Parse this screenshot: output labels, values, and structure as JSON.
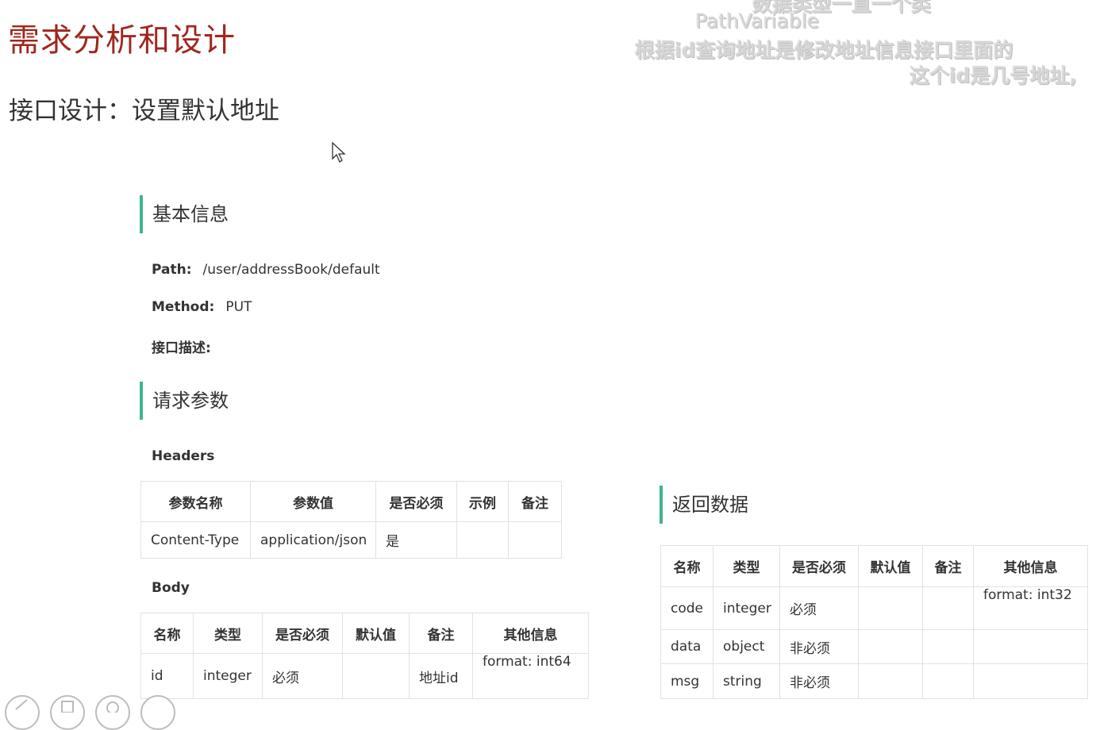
{
  "title": "需求分析和设计",
  "subtitle": "接口设计：设置默认地址",
  "overlay": {
    "line0": "数据类型一直一个类",
    "line1": "PathVariable",
    "line2": "根据id查询地址是修改地址信息接口里面的",
    "line3": "这个id是几号地址,"
  },
  "basic": {
    "heading": "基本信息",
    "path_label": "Path:",
    "path_value": "/user/addressBook/default",
    "method_label": "Method:",
    "method_value": "PUT",
    "desc_label": "接口描述:"
  },
  "request": {
    "heading": "请求参数",
    "headers_label": "Headers",
    "headers_table": {
      "columns": [
        "参数名称",
        "参数值",
        "是否必须",
        "示例",
        "备注"
      ],
      "rows": [
        [
          "Content-Type",
          "application/json",
          "是",
          "",
          ""
        ]
      ]
    },
    "body_label": "Body",
    "body_table": {
      "columns": [
        "名称",
        "类型",
        "是否必须",
        "默认值",
        "备注",
        "其他信息"
      ],
      "rows": [
        [
          "id",
          "integer",
          "必须",
          "",
          "地址id",
          "format: int64"
        ]
      ]
    }
  },
  "response": {
    "heading": "返回数据",
    "table": {
      "columns": [
        "名称",
        "类型",
        "是否必须",
        "默认值",
        "备注",
        "其他信息"
      ],
      "rows": [
        [
          "code",
          "integer",
          "必须",
          "",
          "",
          "format: int32"
        ],
        [
          "data",
          "object",
          "非必须",
          "",
          "",
          ""
        ],
        [
          "msg",
          "string",
          "非必须",
          "",
          "",
          ""
        ]
      ]
    }
  },
  "toolbar": [
    "pen-icon",
    "copy-icon",
    "zoom-icon",
    "more-icon"
  ],
  "colors": {
    "title": "#a0271f",
    "accent": "#3fb58a",
    "border": "#e2e2e2"
  }
}
